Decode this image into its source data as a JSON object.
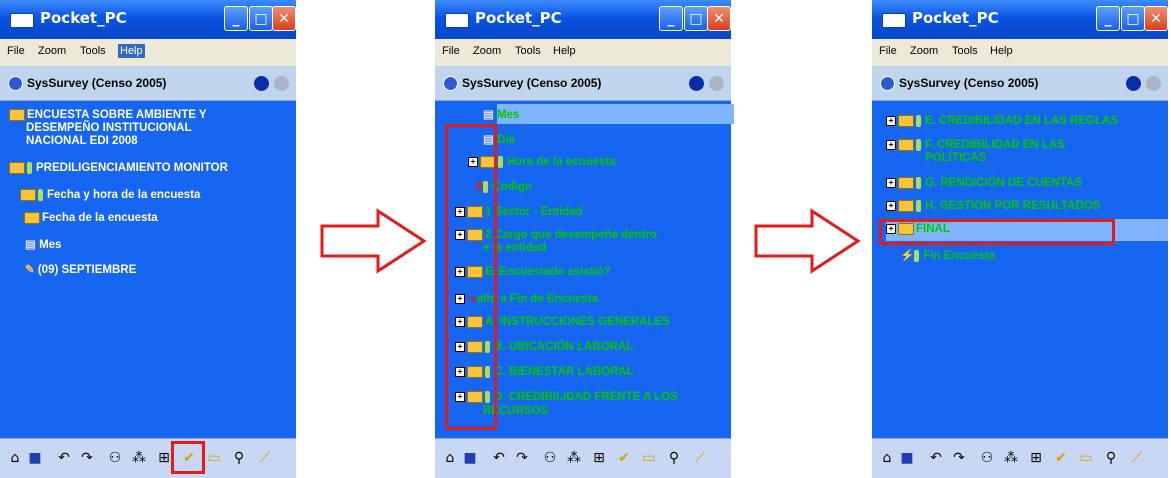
{
  "windows": [
    {
      "title": "Pocket_PC",
      "menu": [
        "File",
        "Zoom",
        "Tools",
        "Help"
      ],
      "app_title": "SysSurvey  (Censo 2005)",
      "items": [
        "ENCUESTA SOBRE AMBIENTE Y",
        "DESEMPEÑO INSTITUCIONAL",
        "NACIONAL EDI 2008",
        "PREDILIGENCIAMIENTO MONITOR",
        "Fecha y hora de la encuesta",
        "Fecha de la encuesta",
        "Mes",
        "(09) SEPTIEMBRE"
      ]
    },
    {
      "title": "Pocket_PC",
      "menu": [
        "File",
        "Zoom",
        "Tools",
        "Help"
      ],
      "app_title": "SysSurvey  (Censo 2005)",
      "items": [
        "Mes",
        "Día",
        "Hora de la ecnuesta",
        "Codigo",
        "1 Sector - Entidad",
        "2 Cargo que desempeña dentro",
        "e la entidad",
        "El Encuestado asistió?",
        "alto a Fin de Encuesta",
        "A. INSTRUCCIONES GENERALES",
        "B. UBICACIÓN LABORAL",
        "C. BIENESTAR LABORAL",
        "D. CREDIBILIDAD FRENTE A LOS",
        "RECURSOS"
      ]
    },
    {
      "title": "Pocket_PC",
      "menu": [
        "File",
        "Zoom",
        "Tools",
        "Help"
      ],
      "app_title": "SysSurvey  (Censo 2005)",
      "items": [
        "E. CREDIBILIDAD EN LAS REGLAS",
        "F. CREDIBILIDAD EN LAS",
        "POLÍTICAS",
        "G. RENDICIÓN DE CUENTAS",
        "H. GESTIÓN POR RESULTADOS",
        "FINAL",
        "Fin Encuesta"
      ]
    }
  ],
  "colors": {
    "window_bg": "#1766f2",
    "item_green": "#00c800",
    "highlight": "#7fb5ff",
    "annotation_red": "#e21b1b"
  },
  "icons": [
    "home-icon",
    "save-icon",
    "undo-icon",
    "redo-icon",
    "tree-icon",
    "branch-icon",
    "expand-tree-icon",
    "check-icon",
    "folder-icon",
    "search-icon",
    "edit-icon"
  ]
}
